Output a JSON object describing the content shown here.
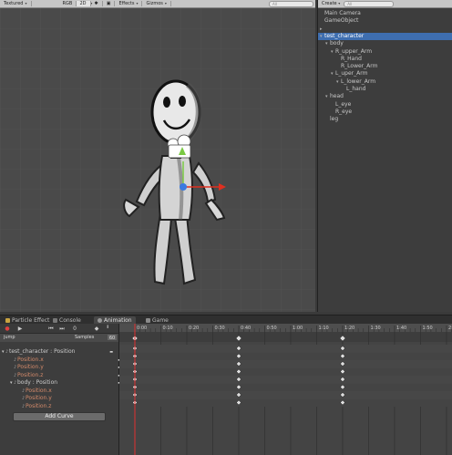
{
  "scene_toolbar": {
    "shading": "Textured",
    "render_mode": "RGB",
    "toggle_2d": "2D",
    "effects": "Effects",
    "gizmos": "Gizmos",
    "search_placeholder": "All"
  },
  "hierarchy": {
    "create_label": "Create",
    "search_placeholder": "All",
    "items": [
      {
        "label": "Main Camera",
        "indent": 0,
        "arrow": ""
      },
      {
        "label": "GameObject",
        "indent": 0,
        "arrow": ""
      },
      {
        "label": "",
        "indent": 0,
        "arrow": "▸"
      },
      {
        "label": "test_character",
        "indent": 0,
        "arrow": "▾",
        "selected": true
      },
      {
        "label": "body",
        "indent": 1,
        "arrow": "▾"
      },
      {
        "label": "R_upper_Arm",
        "indent": 2,
        "arrow": "▾"
      },
      {
        "label": "R_Hand",
        "indent": 3,
        "arrow": ""
      },
      {
        "label": "R_Lower_Arm",
        "indent": 3,
        "arrow": ""
      },
      {
        "label": "L_uper_Arm",
        "indent": 2,
        "arrow": "▾"
      },
      {
        "label": "L_lower_Arm",
        "indent": 3,
        "arrow": "▾"
      },
      {
        "label": "L_hand",
        "indent": 4,
        "arrow": ""
      },
      {
        "label": "head",
        "indent": 1,
        "arrow": "▾"
      },
      {
        "label": "L_eye",
        "indent": 2,
        "arrow": ""
      },
      {
        "label": "R_eye",
        "indent": 2,
        "arrow": ""
      },
      {
        "label": "leg",
        "indent": 1,
        "arrow": ""
      }
    ]
  },
  "bottom_tabs": [
    {
      "label": "Particle Effect",
      "icon": "particle-icon",
      "active": false
    },
    {
      "label": "Console",
      "icon": "console-icon",
      "active": false
    },
    {
      "label": "Animation",
      "icon": "animation-icon",
      "active": true
    },
    {
      "label": "Game",
      "icon": "game-icon",
      "active": false
    }
  ],
  "animation": {
    "clip_name": "jump",
    "samples_label": "Samples",
    "samples_value": "60",
    "frame_value": "0",
    "add_curve_label": "Add Curve",
    "curves": [
      {
        "label": "test_character : Position",
        "kind": "object",
        "indent": 0
      },
      {
        "label": "Position.x",
        "kind": "prop",
        "indent": 1
      },
      {
        "label": "Position.y",
        "kind": "prop",
        "indent": 1
      },
      {
        "label": "Position.z",
        "kind": "prop",
        "indent": 1
      },
      {
        "label": "body : Position",
        "kind": "object",
        "indent": 1
      },
      {
        "label": "Position.x",
        "kind": "prop",
        "indent": 2
      },
      {
        "label": "Position.y",
        "kind": "prop",
        "indent": 2
      },
      {
        "label": "Position.z",
        "kind": "prop",
        "indent": 2
      }
    ],
    "ruler_labels": [
      "0:00",
      "0:10",
      "0:20",
      "0:30",
      "0:40",
      "0:50",
      "1:00",
      "1:10",
      "1:20",
      "1:30",
      "1:40",
      "1:50",
      "2:00"
    ],
    "keyframe_times": [
      "0:00",
      "0:40",
      "1:20"
    ]
  },
  "colors": {
    "selection": "#3e6eb0",
    "property_text": "#d48a6a",
    "x_axis": "#e03020",
    "y_axis": "#7ac943",
    "z_axis": "#3a7ae0"
  }
}
